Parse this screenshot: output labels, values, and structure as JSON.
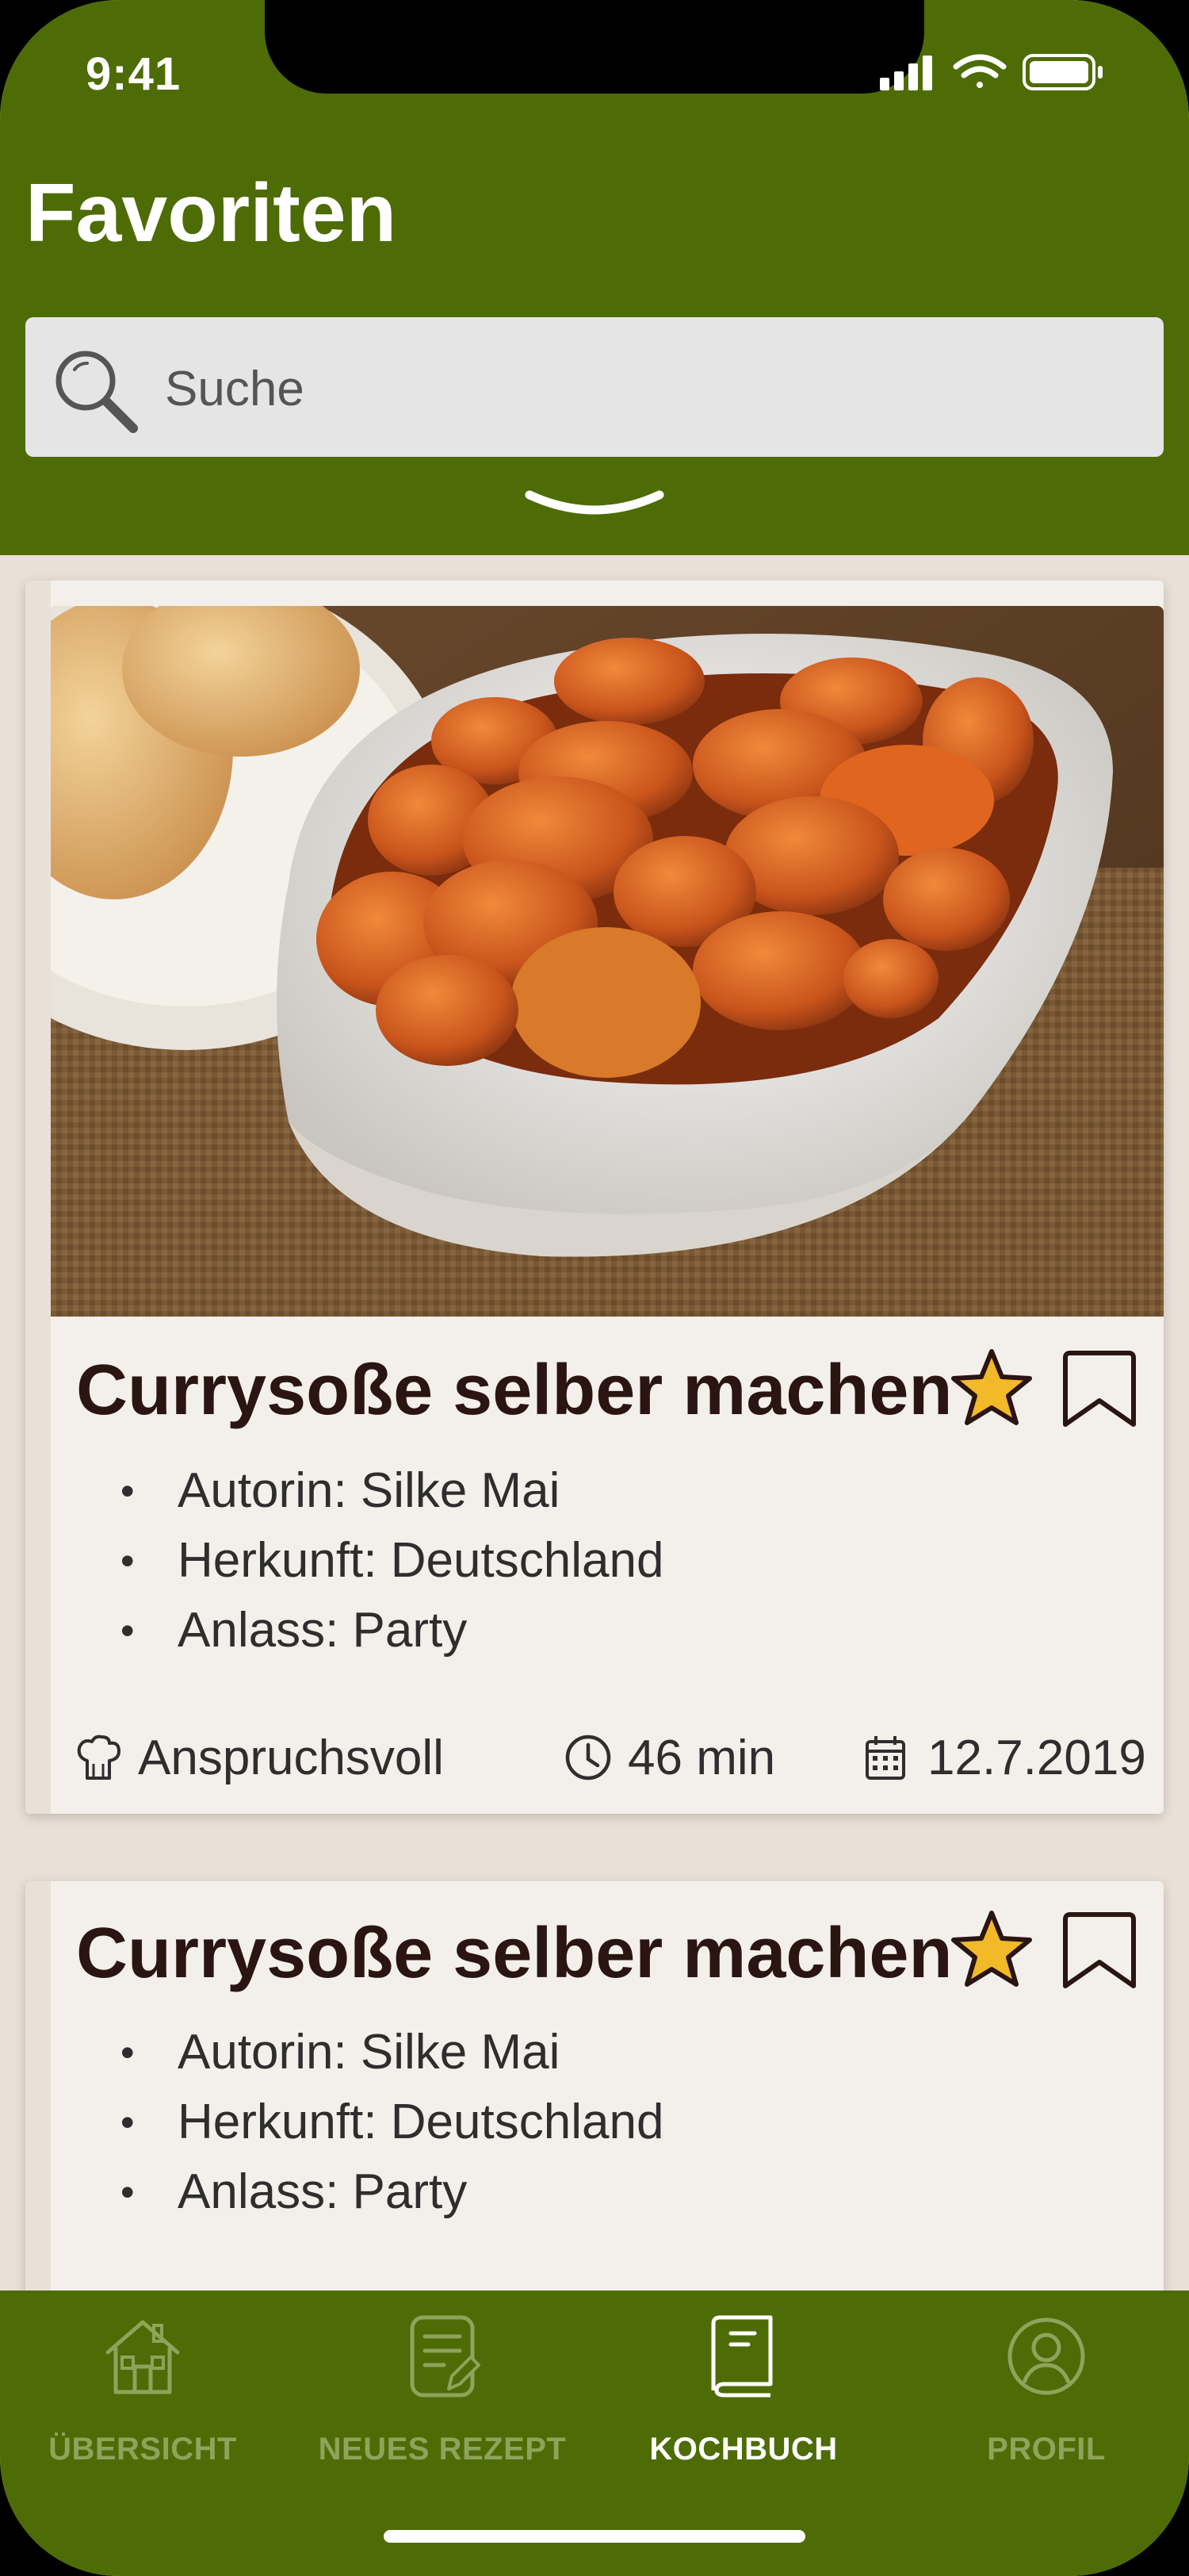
{
  "status_bar": {
    "time": "9:41"
  },
  "header": {
    "title": "Favoriten"
  },
  "search": {
    "placeholder": "Suche"
  },
  "recipes": [
    {
      "title": "Currysoße selber machen",
      "details": [
        "Autorin: Silke Mai",
        "Herkunft: Deutschland",
        "Anlass: Party"
      ],
      "difficulty": "Anspruchsvoll",
      "duration": "46 min",
      "date": "12.7.2019",
      "favorite": true
    },
    {
      "title": "Currysoße selber machen",
      "details": [
        "Autorin: Silke Mai",
        "Herkunft: Deutschland",
        "Anlass: Party"
      ],
      "favorite": true
    }
  ],
  "tabbar": {
    "tabs": [
      {
        "label": "ÜBERSICHT",
        "icon": "house-icon",
        "active": false
      },
      {
        "label": "NEUES REZEPT",
        "icon": "note-edit-icon",
        "active": false
      },
      {
        "label": "KOCHBUCH",
        "icon": "book-icon",
        "active": true
      },
      {
        "label": "PROFIL",
        "icon": "profile-icon",
        "active": false
      }
    ]
  },
  "colors": {
    "primary_green": "#4d6c05",
    "card_background": "#f3f0eb",
    "title_text": "#2a1512",
    "star": "#f2b928",
    "inactive_tab": "#8ea35b"
  }
}
